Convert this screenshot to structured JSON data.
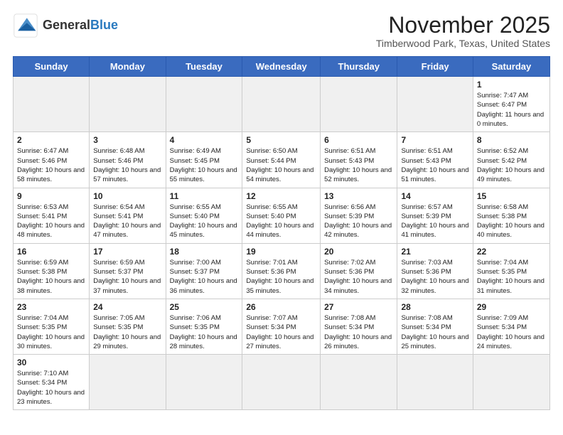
{
  "header": {
    "logo_general": "General",
    "logo_blue": "Blue",
    "month_title": "November 2025",
    "location": "Timberwood Park, Texas, United States"
  },
  "weekdays": [
    "Sunday",
    "Monday",
    "Tuesday",
    "Wednesday",
    "Thursday",
    "Friday",
    "Saturday"
  ],
  "weeks": [
    [
      {
        "day": "",
        "empty": true
      },
      {
        "day": "",
        "empty": true
      },
      {
        "day": "",
        "empty": true
      },
      {
        "day": "",
        "empty": true
      },
      {
        "day": "",
        "empty": true
      },
      {
        "day": "",
        "empty": true
      },
      {
        "day": "1",
        "sunrise": "7:47 AM",
        "sunset": "6:47 PM",
        "daylight": "11 hours and 0 minutes."
      }
    ],
    [
      {
        "day": "2",
        "sunrise": "6:47 AM",
        "sunset": "5:46 PM",
        "daylight": "10 hours and 58 minutes."
      },
      {
        "day": "3",
        "sunrise": "6:48 AM",
        "sunset": "5:46 PM",
        "daylight": "10 hours and 57 minutes."
      },
      {
        "day": "4",
        "sunrise": "6:49 AM",
        "sunset": "5:45 PM",
        "daylight": "10 hours and 55 minutes."
      },
      {
        "day": "5",
        "sunrise": "6:50 AM",
        "sunset": "5:44 PM",
        "daylight": "10 hours and 54 minutes."
      },
      {
        "day": "6",
        "sunrise": "6:51 AM",
        "sunset": "5:43 PM",
        "daylight": "10 hours and 52 minutes."
      },
      {
        "day": "7",
        "sunrise": "6:51 AM",
        "sunset": "5:43 PM",
        "daylight": "10 hours and 51 minutes."
      },
      {
        "day": "8",
        "sunrise": "6:52 AM",
        "sunset": "5:42 PM",
        "daylight": "10 hours and 49 minutes."
      }
    ],
    [
      {
        "day": "9",
        "sunrise": "6:53 AM",
        "sunset": "5:41 PM",
        "daylight": "10 hours and 48 minutes."
      },
      {
        "day": "10",
        "sunrise": "6:54 AM",
        "sunset": "5:41 PM",
        "daylight": "10 hours and 47 minutes."
      },
      {
        "day": "11",
        "sunrise": "6:55 AM",
        "sunset": "5:40 PM",
        "daylight": "10 hours and 45 minutes."
      },
      {
        "day": "12",
        "sunrise": "6:55 AM",
        "sunset": "5:40 PM",
        "daylight": "10 hours and 44 minutes."
      },
      {
        "day": "13",
        "sunrise": "6:56 AM",
        "sunset": "5:39 PM",
        "daylight": "10 hours and 42 minutes."
      },
      {
        "day": "14",
        "sunrise": "6:57 AM",
        "sunset": "5:39 PM",
        "daylight": "10 hours and 41 minutes."
      },
      {
        "day": "15",
        "sunrise": "6:58 AM",
        "sunset": "5:38 PM",
        "daylight": "10 hours and 40 minutes."
      }
    ],
    [
      {
        "day": "16",
        "sunrise": "6:59 AM",
        "sunset": "5:38 PM",
        "daylight": "10 hours and 38 minutes."
      },
      {
        "day": "17",
        "sunrise": "6:59 AM",
        "sunset": "5:37 PM",
        "daylight": "10 hours and 37 minutes."
      },
      {
        "day": "18",
        "sunrise": "7:00 AM",
        "sunset": "5:37 PM",
        "daylight": "10 hours and 36 minutes."
      },
      {
        "day": "19",
        "sunrise": "7:01 AM",
        "sunset": "5:36 PM",
        "daylight": "10 hours and 35 minutes."
      },
      {
        "day": "20",
        "sunrise": "7:02 AM",
        "sunset": "5:36 PM",
        "daylight": "10 hours and 34 minutes."
      },
      {
        "day": "21",
        "sunrise": "7:03 AM",
        "sunset": "5:36 PM",
        "daylight": "10 hours and 32 minutes."
      },
      {
        "day": "22",
        "sunrise": "7:04 AM",
        "sunset": "5:35 PM",
        "daylight": "10 hours and 31 minutes."
      }
    ],
    [
      {
        "day": "23",
        "sunrise": "7:04 AM",
        "sunset": "5:35 PM",
        "daylight": "10 hours and 30 minutes."
      },
      {
        "day": "24",
        "sunrise": "7:05 AM",
        "sunset": "5:35 PM",
        "daylight": "10 hours and 29 minutes."
      },
      {
        "day": "25",
        "sunrise": "7:06 AM",
        "sunset": "5:35 PM",
        "daylight": "10 hours and 28 minutes."
      },
      {
        "day": "26",
        "sunrise": "7:07 AM",
        "sunset": "5:34 PM",
        "daylight": "10 hours and 27 minutes."
      },
      {
        "day": "27",
        "sunrise": "7:08 AM",
        "sunset": "5:34 PM",
        "daylight": "10 hours and 26 minutes."
      },
      {
        "day": "28",
        "sunrise": "7:08 AM",
        "sunset": "5:34 PM",
        "daylight": "10 hours and 25 minutes."
      },
      {
        "day": "29",
        "sunrise": "7:09 AM",
        "sunset": "5:34 PM",
        "daylight": "10 hours and 24 minutes."
      }
    ],
    [
      {
        "day": "30",
        "sunrise": "7:10 AM",
        "sunset": "5:34 PM",
        "daylight": "10 hours and 23 minutes."
      },
      {
        "day": "",
        "empty": true
      },
      {
        "day": "",
        "empty": true
      },
      {
        "day": "",
        "empty": true
      },
      {
        "day": "",
        "empty": true
      },
      {
        "day": "",
        "empty": true
      },
      {
        "day": "",
        "empty": true
      }
    ]
  ],
  "labels": {
    "sunrise": "Sunrise:",
    "sunset": "Sunset:",
    "daylight": "Daylight:"
  }
}
